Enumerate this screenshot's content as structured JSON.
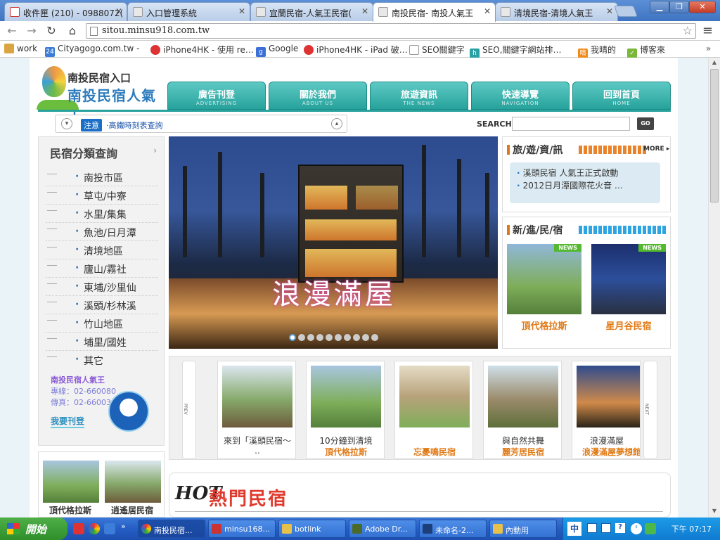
{
  "browser": {
    "tabs": [
      {
        "title": "收件匣 (210) - 0988072(",
        "active": false,
        "icon": "gmail-icon"
      },
      {
        "title": "入口管理系統",
        "active": false,
        "icon": "page-icon"
      },
      {
        "title": "宜蘭民宿-人氣王民宿(",
        "active": false,
        "icon": "page-icon"
      },
      {
        "title": "南投民宿- 南投人氣王",
        "active": true,
        "icon": "page-icon"
      },
      {
        "title": "清境民宿-清境人氣王",
        "active": false,
        "icon": "page-icon"
      }
    ],
    "url": "sitou.minsu918.com.tw",
    "bookmarks": [
      {
        "label": "work",
        "icon": "folder-icon"
      },
      {
        "label": "Cityagogo.com.tw -",
        "icon": "calendar-icon"
      },
      {
        "label": "iPhone4HK - 使用 re…",
        "icon": "phone-icon"
      },
      {
        "label": "Google",
        "icon": "google-icon"
      },
      {
        "label": "iPhone4HK - iPad 破…",
        "icon": "phone-icon"
      },
      {
        "label": "SEO關鍵字",
        "icon": "page-icon"
      },
      {
        "label": "SEO,關鍵字網站排…",
        "icon": "hm-icon"
      },
      {
        "label": "我晴的",
        "icon": "orange-icon"
      },
      {
        "label": "博客來",
        "icon": "green-icon"
      }
    ]
  },
  "site": {
    "logo_small": "南投民宿入口",
    "logo_big": "南投民宿人氣王",
    "nav": [
      {
        "label": "廣告刊登",
        "sub": "ADVERTISING"
      },
      {
        "label": "關於我們",
        "sub": "ABOUT US"
      },
      {
        "label": "旅遊資訊",
        "sub": "THE NEWS"
      },
      {
        "label": "快速導覽",
        "sub": "NAVIGATION"
      },
      {
        "label": "回到首頁",
        "sub": "HOME"
      }
    ],
    "notice_tag": "注意",
    "notice_text": "‧高鐵時刻表查詢",
    "search_label": "SEARCH",
    "search_value": "",
    "go_label": "GO",
    "category_title": "民宿分類查詢",
    "categories": [
      "南投市區",
      "草屯/中寮",
      "水里/集集",
      "魚池/日月潭",
      "清境地區",
      "廬山/霧社",
      "東埔/沙里仙",
      "溪頭/杉林溪",
      "竹山地區",
      "埔里/國姓",
      "其它"
    ],
    "promo": {
      "name": "南投民宿人氣王",
      "phone1": "專線：02-660080",
      "phone2": "傳真：02-660036",
      "register": "我要刊登"
    },
    "hero_caption": "浪漫滿屋",
    "hero_dots": 10,
    "travel_title": "旅/遊/資/訊",
    "more_label": "MORE ▸",
    "travel_news": [
      "溪頭民宿 人氣王正式啟動",
      "2012日月潭國際花火音 …"
    ],
    "new_title": "新/進/民/宿",
    "new_badge": "NEWS",
    "new_items": [
      "頂代格拉斯",
      "星月谷民宿"
    ],
    "prev_label": "PREV",
    "next_label": "NEXT",
    "carousel": [
      {
        "line1": "來到「溪頭民宿～",
        "line2": "‥"
      },
      {
        "line1": "10分鐘到清境",
        "line2": "頂代格拉斯"
      },
      {
        "line1": "",
        "line2": "忘憂鳴民宿"
      },
      {
        "line1": "與自然共舞",
        "line2": "麗芳居民宿"
      },
      {
        "line1": "浪漫滿屋",
        "line2": "浪漫滿屋夢想館"
      }
    ],
    "left_thumbs": [
      "頂代格拉斯",
      "逍遙居民宿"
    ],
    "hot_prefix": "HOT",
    "hot_title": "熱門民宿"
  },
  "taskbar": {
    "start": "開始",
    "items": [
      {
        "label": "南投民宿...",
        "active": true
      },
      {
        "label": "minsu168...",
        "active": false
      },
      {
        "label": "botlink",
        "active": false
      },
      {
        "label": "Adobe Dr...",
        "active": false
      },
      {
        "label": "未命名-2...",
        "active": false
      },
      {
        "label": "內動用",
        "active": false
      }
    ],
    "lang": "中",
    "clock": "下午 07:17"
  },
  "colors": {
    "accent": "#27a29c",
    "orange": "#e07a16",
    "taskbar": "#245dc4"
  }
}
